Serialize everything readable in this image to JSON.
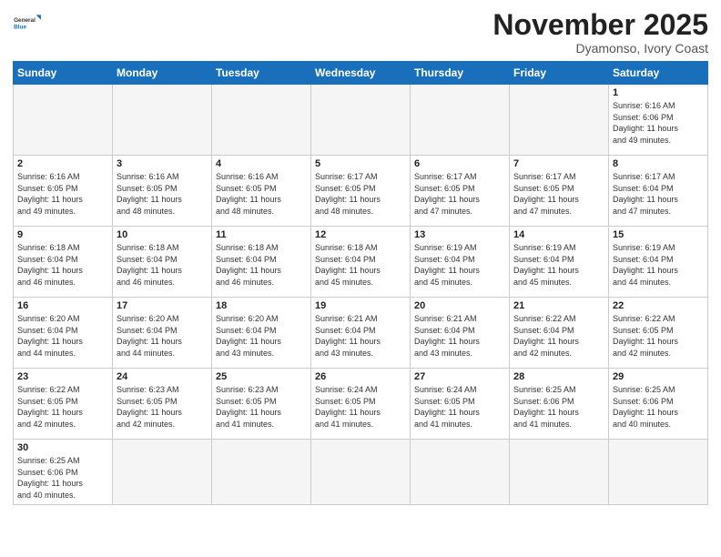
{
  "header": {
    "logo_general": "General",
    "logo_blue": "Blue",
    "month_title": "November 2025",
    "location": "Dyamonso, Ivory Coast"
  },
  "weekdays": [
    "Sunday",
    "Monday",
    "Tuesday",
    "Wednesday",
    "Thursday",
    "Friday",
    "Saturday"
  ],
  "weeks": [
    [
      {
        "day": "",
        "info": ""
      },
      {
        "day": "",
        "info": ""
      },
      {
        "day": "",
        "info": ""
      },
      {
        "day": "",
        "info": ""
      },
      {
        "day": "",
        "info": ""
      },
      {
        "day": "",
        "info": ""
      },
      {
        "day": "1",
        "info": "Sunrise: 6:16 AM\nSunset: 6:06 PM\nDaylight: 11 hours\nand 49 minutes."
      }
    ],
    [
      {
        "day": "2",
        "info": "Sunrise: 6:16 AM\nSunset: 6:05 PM\nDaylight: 11 hours\nand 49 minutes."
      },
      {
        "day": "3",
        "info": "Sunrise: 6:16 AM\nSunset: 6:05 PM\nDaylight: 11 hours\nand 48 minutes."
      },
      {
        "day": "4",
        "info": "Sunrise: 6:16 AM\nSunset: 6:05 PM\nDaylight: 11 hours\nand 48 minutes."
      },
      {
        "day": "5",
        "info": "Sunrise: 6:17 AM\nSunset: 6:05 PM\nDaylight: 11 hours\nand 48 minutes."
      },
      {
        "day": "6",
        "info": "Sunrise: 6:17 AM\nSunset: 6:05 PM\nDaylight: 11 hours\nand 47 minutes."
      },
      {
        "day": "7",
        "info": "Sunrise: 6:17 AM\nSunset: 6:05 PM\nDaylight: 11 hours\nand 47 minutes."
      },
      {
        "day": "8",
        "info": "Sunrise: 6:17 AM\nSunset: 6:04 PM\nDaylight: 11 hours\nand 47 minutes."
      }
    ],
    [
      {
        "day": "9",
        "info": "Sunrise: 6:18 AM\nSunset: 6:04 PM\nDaylight: 11 hours\nand 46 minutes."
      },
      {
        "day": "10",
        "info": "Sunrise: 6:18 AM\nSunset: 6:04 PM\nDaylight: 11 hours\nand 46 minutes."
      },
      {
        "day": "11",
        "info": "Sunrise: 6:18 AM\nSunset: 6:04 PM\nDaylight: 11 hours\nand 46 minutes."
      },
      {
        "day": "12",
        "info": "Sunrise: 6:18 AM\nSunset: 6:04 PM\nDaylight: 11 hours\nand 45 minutes."
      },
      {
        "day": "13",
        "info": "Sunrise: 6:19 AM\nSunset: 6:04 PM\nDaylight: 11 hours\nand 45 minutes."
      },
      {
        "day": "14",
        "info": "Sunrise: 6:19 AM\nSunset: 6:04 PM\nDaylight: 11 hours\nand 45 minutes."
      },
      {
        "day": "15",
        "info": "Sunrise: 6:19 AM\nSunset: 6:04 PM\nDaylight: 11 hours\nand 44 minutes."
      }
    ],
    [
      {
        "day": "16",
        "info": "Sunrise: 6:20 AM\nSunset: 6:04 PM\nDaylight: 11 hours\nand 44 minutes."
      },
      {
        "day": "17",
        "info": "Sunrise: 6:20 AM\nSunset: 6:04 PM\nDaylight: 11 hours\nand 44 minutes."
      },
      {
        "day": "18",
        "info": "Sunrise: 6:20 AM\nSunset: 6:04 PM\nDaylight: 11 hours\nand 43 minutes."
      },
      {
        "day": "19",
        "info": "Sunrise: 6:21 AM\nSunset: 6:04 PM\nDaylight: 11 hours\nand 43 minutes."
      },
      {
        "day": "20",
        "info": "Sunrise: 6:21 AM\nSunset: 6:04 PM\nDaylight: 11 hours\nand 43 minutes."
      },
      {
        "day": "21",
        "info": "Sunrise: 6:22 AM\nSunset: 6:04 PM\nDaylight: 11 hours\nand 42 minutes."
      },
      {
        "day": "22",
        "info": "Sunrise: 6:22 AM\nSunset: 6:05 PM\nDaylight: 11 hours\nand 42 minutes."
      }
    ],
    [
      {
        "day": "23",
        "info": "Sunrise: 6:22 AM\nSunset: 6:05 PM\nDaylight: 11 hours\nand 42 minutes."
      },
      {
        "day": "24",
        "info": "Sunrise: 6:23 AM\nSunset: 6:05 PM\nDaylight: 11 hours\nand 42 minutes."
      },
      {
        "day": "25",
        "info": "Sunrise: 6:23 AM\nSunset: 6:05 PM\nDaylight: 11 hours\nand 41 minutes."
      },
      {
        "day": "26",
        "info": "Sunrise: 6:24 AM\nSunset: 6:05 PM\nDaylight: 11 hours\nand 41 minutes."
      },
      {
        "day": "27",
        "info": "Sunrise: 6:24 AM\nSunset: 6:05 PM\nDaylight: 11 hours\nand 41 minutes."
      },
      {
        "day": "28",
        "info": "Sunrise: 6:25 AM\nSunset: 6:06 PM\nDaylight: 11 hours\nand 41 minutes."
      },
      {
        "day": "29",
        "info": "Sunrise: 6:25 AM\nSunset: 6:06 PM\nDaylight: 11 hours\nand 40 minutes."
      }
    ],
    [
      {
        "day": "30",
        "info": "Sunrise: 6:25 AM\nSunset: 6:06 PM\nDaylight: 11 hours\nand 40 minutes."
      },
      {
        "day": "",
        "info": ""
      },
      {
        "day": "",
        "info": ""
      },
      {
        "day": "",
        "info": ""
      },
      {
        "day": "",
        "info": ""
      },
      {
        "day": "",
        "info": ""
      },
      {
        "day": "",
        "info": ""
      }
    ]
  ]
}
